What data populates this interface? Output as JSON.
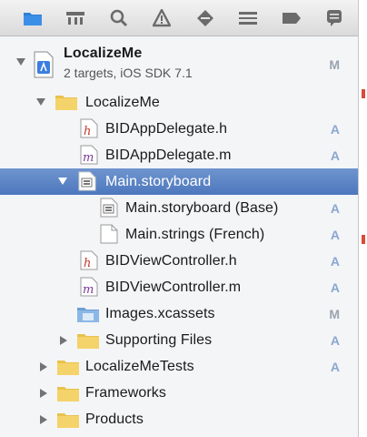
{
  "toolbar": {
    "icons": [
      "folder-icon",
      "hierarchy-icon",
      "search-icon",
      "warning-icon",
      "breakpoint-diamond-icon",
      "list-icon",
      "tag-icon",
      "speech-bubble-icon"
    ]
  },
  "project": {
    "name": "LocalizeMe",
    "subtitle": "2 targets, iOS SDK 7.1",
    "badge": "M"
  },
  "tree": {
    "group_localizeme": {
      "label": "LocalizeMe"
    },
    "delegate_h": {
      "label": "BIDAppDelegate.h",
      "badge": "A",
      "icon_letter": "h"
    },
    "delegate_m": {
      "label": "BIDAppDelegate.m",
      "badge": "A",
      "icon_letter": "m"
    },
    "storyboard": {
      "label": "Main.storyboard"
    },
    "storyboard_base": {
      "label": "Main.storyboard (Base)",
      "badge": "A"
    },
    "strings_french": {
      "label": "Main.strings (French)",
      "badge": "A"
    },
    "viewcontroller_h": {
      "label": "BIDViewController.h",
      "badge": "A",
      "icon_letter": "h"
    },
    "viewcontroller_m": {
      "label": "BIDViewController.m",
      "badge": "A",
      "icon_letter": "m"
    },
    "images": {
      "label": "Images.xcassets",
      "badge": "M"
    },
    "supporting": {
      "label": "Supporting Files",
      "badge": "A"
    },
    "tests": {
      "label": "LocalizeMeTests",
      "badge": "A"
    },
    "frameworks": {
      "label": "Frameworks"
    },
    "products": {
      "label": "Products"
    }
  },
  "colors": {
    "selection": "#5a82c4",
    "folder": "#f2cf5c",
    "badge": "#8aa7cf"
  }
}
